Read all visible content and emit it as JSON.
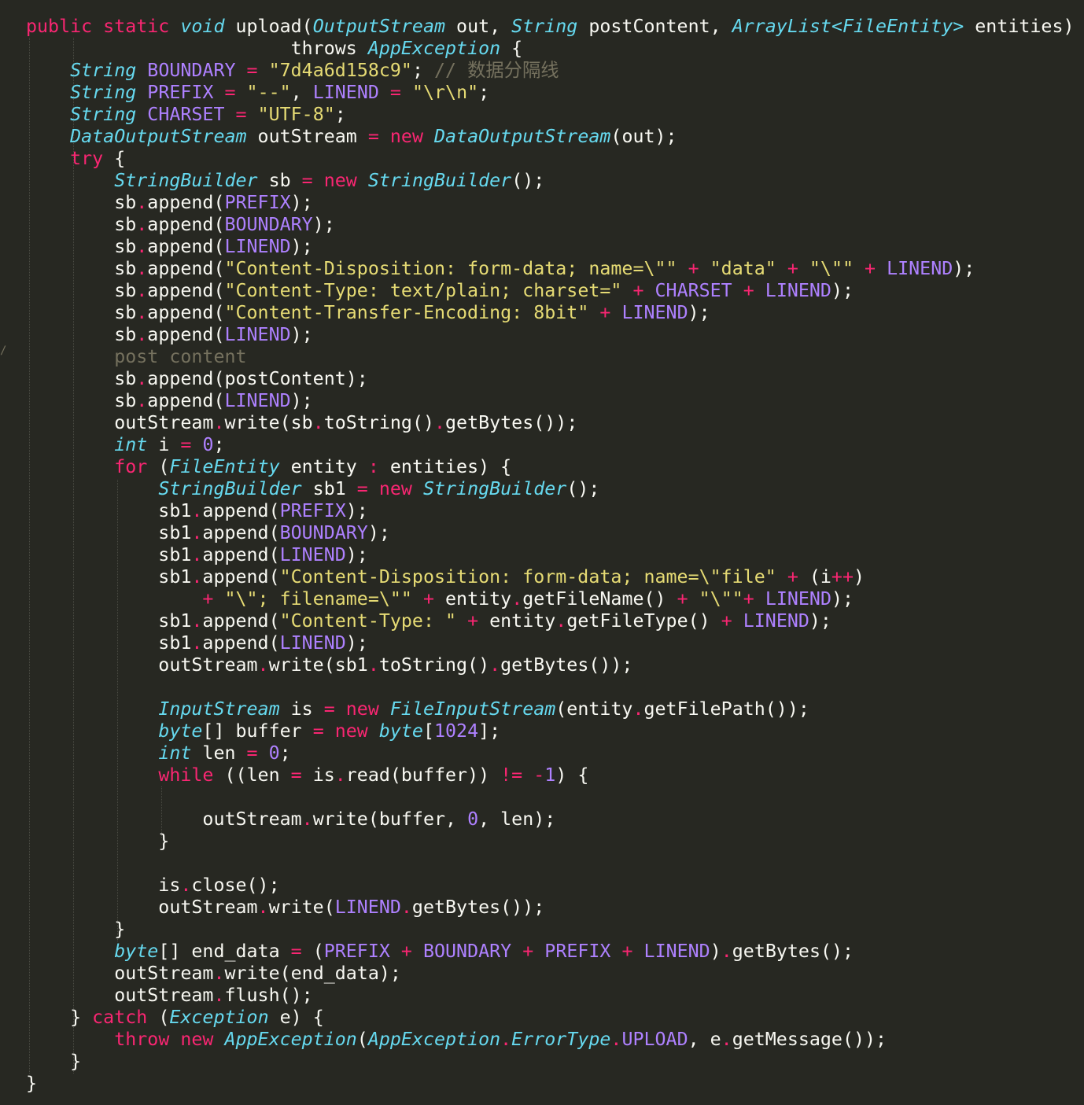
{
  "editor": {
    "language": "Java",
    "theme": "Monokai",
    "colors": {
      "background": "#272822",
      "foreground": "#F8F8F2",
      "keyword": "#F92672",
      "type": "#66D9EF",
      "string": "#E6DB74",
      "comment": "#75715E",
      "constant": "#AE81FF"
    },
    "lines": [
      [
        [
          "kw",
          "public static "
        ],
        [
          "ty",
          "void"
        ],
        [
          "p",
          " upload("
        ],
        [
          "ty",
          "OutputStream"
        ],
        [
          "p",
          " out, "
        ],
        [
          "ty",
          "String"
        ],
        [
          "p",
          " postContent, "
        ],
        [
          "ty",
          "ArrayList<FileEntity>"
        ],
        [
          "p",
          " entities)"
        ]
      ],
      [
        [
          "p",
          "                        throws "
        ],
        [
          "ty",
          "AppException"
        ],
        [
          "p",
          " {"
        ]
      ],
      [
        [
          "p",
          "    "
        ],
        [
          "ty",
          "String"
        ],
        [
          "p",
          " "
        ],
        [
          "con",
          "BOUNDARY"
        ],
        [
          "p",
          " "
        ],
        [
          "op",
          "="
        ],
        [
          "p",
          " "
        ],
        [
          "st",
          "\"7d4a6d158c9\""
        ],
        [
          "p",
          "; "
        ],
        [
          "cm",
          "// 数据分隔线"
        ]
      ],
      [
        [
          "p",
          "    "
        ],
        [
          "ty",
          "String"
        ],
        [
          "p",
          " "
        ],
        [
          "con",
          "PREFIX"
        ],
        [
          "p",
          " "
        ],
        [
          "op",
          "="
        ],
        [
          "p",
          " "
        ],
        [
          "st",
          "\"--\""
        ],
        [
          "p",
          ", "
        ],
        [
          "con",
          "LINEND"
        ],
        [
          "p",
          " "
        ],
        [
          "op",
          "="
        ],
        [
          "p",
          " "
        ],
        [
          "st",
          "\"\\r\\n\""
        ],
        [
          "p",
          ";"
        ]
      ],
      [
        [
          "p",
          "    "
        ],
        [
          "ty",
          "String"
        ],
        [
          "p",
          " "
        ],
        [
          "con",
          "CHARSET"
        ],
        [
          "p",
          " "
        ],
        [
          "op",
          "="
        ],
        [
          "p",
          " "
        ],
        [
          "st",
          "\"UTF-8\""
        ],
        [
          "p",
          ";"
        ]
      ],
      [
        [
          "p",
          "    "
        ],
        [
          "ty",
          "DataOutputStream"
        ],
        [
          "p",
          " outStream "
        ],
        [
          "op",
          "="
        ],
        [
          "p",
          " "
        ],
        [
          "kw",
          "new"
        ],
        [
          "p",
          " "
        ],
        [
          "ty",
          "DataOutputStream"
        ],
        [
          "p",
          "(out);"
        ]
      ],
      [
        [
          "p",
          "    "
        ],
        [
          "kw",
          "try"
        ],
        [
          "p",
          " {"
        ]
      ],
      [
        [
          "p",
          "        "
        ],
        [
          "ty",
          "StringBuilder"
        ],
        [
          "p",
          " sb "
        ],
        [
          "op",
          "="
        ],
        [
          "p",
          " "
        ],
        [
          "kw",
          "new"
        ],
        [
          "p",
          " "
        ],
        [
          "ty",
          "StringBuilder"
        ],
        [
          "p",
          "();"
        ]
      ],
      [
        [
          "p",
          "        sb"
        ],
        [
          "op",
          "."
        ],
        [
          "p",
          "append("
        ],
        [
          "con",
          "PREFIX"
        ],
        [
          "p",
          ");"
        ]
      ],
      [
        [
          "p",
          "        sb"
        ],
        [
          "op",
          "."
        ],
        [
          "p",
          "append("
        ],
        [
          "con",
          "BOUNDARY"
        ],
        [
          "p",
          ");"
        ]
      ],
      [
        [
          "p",
          "        sb"
        ],
        [
          "op",
          "."
        ],
        [
          "p",
          "append("
        ],
        [
          "con",
          "LINEND"
        ],
        [
          "p",
          ");"
        ]
      ],
      [
        [
          "p",
          "        sb"
        ],
        [
          "op",
          "."
        ],
        [
          "p",
          "append("
        ],
        [
          "st",
          "\"Content-Disposition: form-data; name=\\\"\""
        ],
        [
          "p",
          " "
        ],
        [
          "op",
          "+"
        ],
        [
          "p",
          " "
        ],
        [
          "st",
          "\"data\""
        ],
        [
          "p",
          " "
        ],
        [
          "op",
          "+"
        ],
        [
          "p",
          " "
        ],
        [
          "st",
          "\"\\\"\""
        ],
        [
          "p",
          " "
        ],
        [
          "op",
          "+"
        ],
        [
          "p",
          " "
        ],
        [
          "con",
          "LINEND"
        ],
        [
          "p",
          ");"
        ]
      ],
      [
        [
          "p",
          "        sb"
        ],
        [
          "op",
          "."
        ],
        [
          "p",
          "append("
        ],
        [
          "st",
          "\"Content-Type: text/plain; charset=\""
        ],
        [
          "p",
          " "
        ],
        [
          "op",
          "+"
        ],
        [
          "p",
          " "
        ],
        [
          "con",
          "CHARSET"
        ],
        [
          "p",
          " "
        ],
        [
          "op",
          "+"
        ],
        [
          "p",
          " "
        ],
        [
          "con",
          "LINEND"
        ],
        [
          "p",
          ");"
        ]
      ],
      [
        [
          "p",
          "        sb"
        ],
        [
          "op",
          "."
        ],
        [
          "p",
          "append("
        ],
        [
          "st",
          "\"Content-Transfer-Encoding: 8bit\""
        ],
        [
          "p",
          " "
        ],
        [
          "op",
          "+"
        ],
        [
          "p",
          " "
        ],
        [
          "con",
          "LINEND"
        ],
        [
          "p",
          ");"
        ]
      ],
      [
        [
          "p",
          "        sb"
        ],
        [
          "op",
          "."
        ],
        [
          "p",
          "append("
        ],
        [
          "con",
          "LINEND"
        ],
        [
          "p",
          ");"
        ]
      ],
      [
        [
          "p",
          "        "
        ],
        [
          "cm",
          "post content"
        ]
      ],
      [
        [
          "p",
          "        sb"
        ],
        [
          "op",
          "."
        ],
        [
          "p",
          "append(postContent);"
        ]
      ],
      [
        [
          "p",
          "        sb"
        ],
        [
          "op",
          "."
        ],
        [
          "p",
          "append("
        ],
        [
          "con",
          "LINEND"
        ],
        [
          "p",
          ");"
        ]
      ],
      [
        [
          "p",
          "        outStream"
        ],
        [
          "op",
          "."
        ],
        [
          "p",
          "write(sb"
        ],
        [
          "op",
          "."
        ],
        [
          "p",
          "toString()"
        ],
        [
          "op",
          "."
        ],
        [
          "p",
          "getBytes());"
        ]
      ],
      [
        [
          "p",
          "        "
        ],
        [
          "ty",
          "int"
        ],
        [
          "p",
          " i "
        ],
        [
          "op",
          "="
        ],
        [
          "p",
          " "
        ],
        [
          "num",
          "0"
        ],
        [
          "p",
          ";"
        ]
      ],
      [
        [
          "p",
          "        "
        ],
        [
          "kw",
          "for"
        ],
        [
          "p",
          " ("
        ],
        [
          "ty",
          "FileEntity"
        ],
        [
          "p",
          " entity "
        ],
        [
          "op",
          ":"
        ],
        [
          "p",
          " entities) {"
        ]
      ],
      [
        [
          "p",
          "            "
        ],
        [
          "ty",
          "StringBuilder"
        ],
        [
          "p",
          " sb1 "
        ],
        [
          "op",
          "="
        ],
        [
          "p",
          " "
        ],
        [
          "kw",
          "new"
        ],
        [
          "p",
          " "
        ],
        [
          "ty",
          "StringBuilder"
        ],
        [
          "p",
          "();"
        ]
      ],
      [
        [
          "p",
          "            sb1"
        ],
        [
          "op",
          "."
        ],
        [
          "p",
          "append("
        ],
        [
          "con",
          "PREFIX"
        ],
        [
          "p",
          ");"
        ]
      ],
      [
        [
          "p",
          "            sb1"
        ],
        [
          "op",
          "."
        ],
        [
          "p",
          "append("
        ],
        [
          "con",
          "BOUNDARY"
        ],
        [
          "p",
          ");"
        ]
      ],
      [
        [
          "p",
          "            sb1"
        ],
        [
          "op",
          "."
        ],
        [
          "p",
          "append("
        ],
        [
          "con",
          "LINEND"
        ],
        [
          "p",
          ");"
        ]
      ],
      [
        [
          "p",
          "            sb1"
        ],
        [
          "op",
          "."
        ],
        [
          "p",
          "append("
        ],
        [
          "st",
          "\"Content-Disposition: form-data; name=\\\"file\""
        ],
        [
          "p",
          " "
        ],
        [
          "op",
          "+"
        ],
        [
          "p",
          " (i"
        ],
        [
          "op",
          "++"
        ],
        [
          "p",
          ")"
        ]
      ],
      [
        [
          "p",
          "                "
        ],
        [
          "op",
          "+"
        ],
        [
          "p",
          " "
        ],
        [
          "st",
          "\"\\\"; filename=\\\"\""
        ],
        [
          "p",
          " "
        ],
        [
          "op",
          "+"
        ],
        [
          "p",
          " entity"
        ],
        [
          "op",
          "."
        ],
        [
          "p",
          "getFileName() "
        ],
        [
          "op",
          "+"
        ],
        [
          "p",
          " "
        ],
        [
          "st",
          "\"\\\"\""
        ],
        [
          "op",
          "+"
        ],
        [
          "p",
          " "
        ],
        [
          "con",
          "LINEND"
        ],
        [
          "p",
          ");"
        ]
      ],
      [
        [
          "p",
          "            sb1"
        ],
        [
          "op",
          "."
        ],
        [
          "p",
          "append("
        ],
        [
          "st",
          "\"Content-Type: \""
        ],
        [
          "p",
          " "
        ],
        [
          "op",
          "+"
        ],
        [
          "p",
          " entity"
        ],
        [
          "op",
          "."
        ],
        [
          "p",
          "getFileType() "
        ],
        [
          "op",
          "+"
        ],
        [
          "p",
          " "
        ],
        [
          "con",
          "LINEND"
        ],
        [
          "p",
          ");"
        ]
      ],
      [
        [
          "p",
          "            sb1"
        ],
        [
          "op",
          "."
        ],
        [
          "p",
          "append("
        ],
        [
          "con",
          "LINEND"
        ],
        [
          "p",
          ");"
        ]
      ],
      [
        [
          "p",
          "            outStream"
        ],
        [
          "op",
          "."
        ],
        [
          "p",
          "write(sb1"
        ],
        [
          "op",
          "."
        ],
        [
          "p",
          "toString()"
        ],
        [
          "op",
          "."
        ],
        [
          "p",
          "getBytes());"
        ]
      ],
      [
        [
          "p",
          ""
        ]
      ],
      [
        [
          "p",
          "            "
        ],
        [
          "ty",
          "InputStream"
        ],
        [
          "p",
          " is "
        ],
        [
          "op",
          "="
        ],
        [
          "p",
          " "
        ],
        [
          "kw",
          "new"
        ],
        [
          "p",
          " "
        ],
        [
          "ty",
          "FileInputStream"
        ],
        [
          "p",
          "(entity"
        ],
        [
          "op",
          "."
        ],
        [
          "p",
          "getFilePath());"
        ]
      ],
      [
        [
          "p",
          "            "
        ],
        [
          "ty",
          "byte"
        ],
        [
          "p",
          "[] buffer "
        ],
        [
          "op",
          "="
        ],
        [
          "p",
          " "
        ],
        [
          "kw",
          "new"
        ],
        [
          "p",
          " "
        ],
        [
          "ty",
          "byte"
        ],
        [
          "p",
          "["
        ],
        [
          "num",
          "1024"
        ],
        [
          "p",
          "];"
        ]
      ],
      [
        [
          "p",
          "            "
        ],
        [
          "ty",
          "int"
        ],
        [
          "p",
          " len "
        ],
        [
          "op",
          "="
        ],
        [
          "p",
          " "
        ],
        [
          "num",
          "0"
        ],
        [
          "p",
          ";"
        ]
      ],
      [
        [
          "p",
          "            "
        ],
        [
          "kw",
          "while"
        ],
        [
          "p",
          " ((len "
        ],
        [
          "op",
          "="
        ],
        [
          "p",
          " is"
        ],
        [
          "op",
          "."
        ],
        [
          "p",
          "read(buffer)) "
        ],
        [
          "op",
          "!="
        ],
        [
          "p",
          " "
        ],
        [
          "op",
          "-"
        ],
        [
          "num",
          "1"
        ],
        [
          "p",
          ") {"
        ]
      ],
      [
        [
          "p",
          ""
        ]
      ],
      [
        [
          "p",
          "                outStream"
        ],
        [
          "op",
          "."
        ],
        [
          "p",
          "write(buffer, "
        ],
        [
          "num",
          "0"
        ],
        [
          "p",
          ", len);"
        ]
      ],
      [
        [
          "p",
          "            }"
        ]
      ],
      [
        [
          "p",
          ""
        ]
      ],
      [
        [
          "p",
          "            is"
        ],
        [
          "op",
          "."
        ],
        [
          "p",
          "close();"
        ]
      ],
      [
        [
          "p",
          "            outStream"
        ],
        [
          "op",
          "."
        ],
        [
          "p",
          "write("
        ],
        [
          "con",
          "LINEND"
        ],
        [
          "op",
          "."
        ],
        [
          "p",
          "getBytes());"
        ]
      ],
      [
        [
          "p",
          "        }"
        ]
      ],
      [
        [
          "p",
          "        "
        ],
        [
          "ty",
          "byte"
        ],
        [
          "p",
          "[] end_data "
        ],
        [
          "op",
          "="
        ],
        [
          "p",
          " ("
        ],
        [
          "con",
          "PREFIX"
        ],
        [
          "p",
          " "
        ],
        [
          "op",
          "+"
        ],
        [
          "p",
          " "
        ],
        [
          "con",
          "BOUNDARY"
        ],
        [
          "p",
          " "
        ],
        [
          "op",
          "+"
        ],
        [
          "p",
          " "
        ],
        [
          "con",
          "PREFIX"
        ],
        [
          "p",
          " "
        ],
        [
          "op",
          "+"
        ],
        [
          "p",
          " "
        ],
        [
          "con",
          "LINEND"
        ],
        [
          "p",
          ")"
        ],
        [
          "op",
          "."
        ],
        [
          "p",
          "getBytes();"
        ]
      ],
      [
        [
          "p",
          "        outStream"
        ],
        [
          "op",
          "."
        ],
        [
          "p",
          "write(end_data);"
        ]
      ],
      [
        [
          "p",
          "        outStream"
        ],
        [
          "op",
          "."
        ],
        [
          "p",
          "flush();"
        ]
      ],
      [
        [
          "p",
          "    } "
        ],
        [
          "kw",
          "catch"
        ],
        [
          "p",
          " ("
        ],
        [
          "ty",
          "Exception"
        ],
        [
          "p",
          " e) {"
        ]
      ],
      [
        [
          "p",
          "        "
        ],
        [
          "kw",
          "throw new"
        ],
        [
          "p",
          " "
        ],
        [
          "ty",
          "AppException"
        ],
        [
          "p",
          "("
        ],
        [
          "ty",
          "AppException"
        ],
        [
          "op",
          "."
        ],
        [
          "ty",
          "ErrorType"
        ],
        [
          "op",
          "."
        ],
        [
          "con",
          "UPLOAD"
        ],
        [
          "p",
          ", e"
        ],
        [
          "op",
          "."
        ],
        [
          "p",
          "getMessage());"
        ]
      ],
      [
        [
          "p",
          "    }"
        ]
      ],
      [
        [
          "p",
          "}"
        ]
      ]
    ]
  }
}
